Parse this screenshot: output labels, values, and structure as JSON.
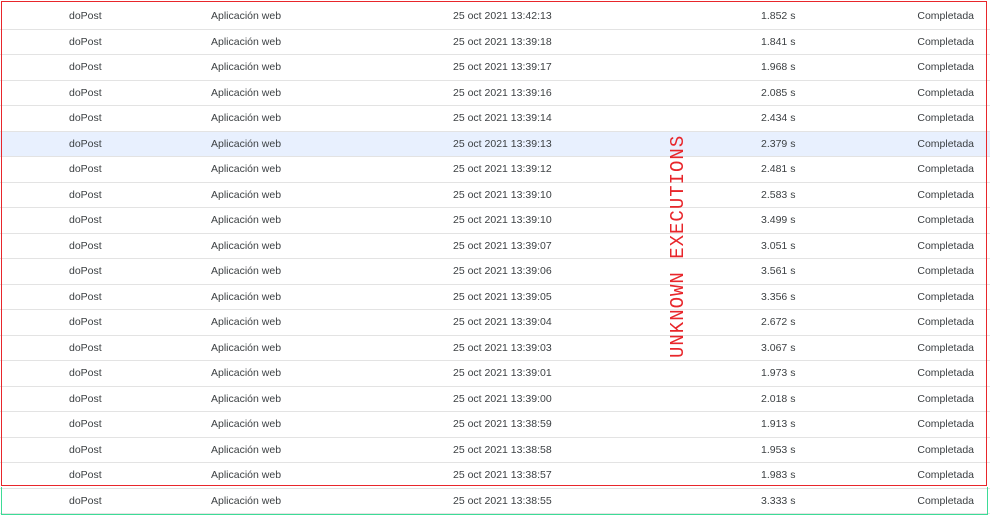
{
  "executions": {
    "rows": [
      {
        "function": "doPost",
        "type": "Aplicación web",
        "started": "25 oct 2021 13:42:13",
        "duration": "1.852 s",
        "status": "Completada"
      },
      {
        "function": "doPost",
        "type": "Aplicación web",
        "started": "25 oct 2021 13:39:18",
        "duration": "1.841 s",
        "status": "Completada"
      },
      {
        "function": "doPost",
        "type": "Aplicación web",
        "started": "25 oct 2021 13:39:17",
        "duration": "1.968 s",
        "status": "Completada"
      },
      {
        "function": "doPost",
        "type": "Aplicación web",
        "started": "25 oct 2021 13:39:16",
        "duration": "2.085 s",
        "status": "Completada"
      },
      {
        "function": "doPost",
        "type": "Aplicación web",
        "started": "25 oct 2021 13:39:14",
        "duration": "2.434 s",
        "status": "Completada"
      },
      {
        "function": "doPost",
        "type": "Aplicación web",
        "started": "25 oct 2021 13:39:13",
        "duration": "2.379 s",
        "status": "Completada"
      },
      {
        "function": "doPost",
        "type": "Aplicación web",
        "started": "25 oct 2021 13:39:12",
        "duration": "2.481 s",
        "status": "Completada"
      },
      {
        "function": "doPost",
        "type": "Aplicación web",
        "started": "25 oct 2021 13:39:10",
        "duration": "2.583 s",
        "status": "Completada"
      },
      {
        "function": "doPost",
        "type": "Aplicación web",
        "started": "25 oct 2021 13:39:10",
        "duration": "3.499 s",
        "status": "Completada"
      },
      {
        "function": "doPost",
        "type": "Aplicación web",
        "started": "25 oct 2021 13:39:07",
        "duration": "3.051 s",
        "status": "Completada"
      },
      {
        "function": "doPost",
        "type": "Aplicación web",
        "started": "25 oct 2021 13:39:06",
        "duration": "3.561 s",
        "status": "Completada"
      },
      {
        "function": "doPost",
        "type": "Aplicación web",
        "started": "25 oct 2021 13:39:05",
        "duration": "3.356 s",
        "status": "Completada"
      },
      {
        "function": "doPost",
        "type": "Aplicación web",
        "started": "25 oct 2021 13:39:04",
        "duration": "2.672 s",
        "status": "Completada"
      },
      {
        "function": "doPost",
        "type": "Aplicación web",
        "started": "25 oct 2021 13:39:03",
        "duration": "3.067 s",
        "status": "Completada"
      },
      {
        "function": "doPost",
        "type": "Aplicación web",
        "started": "25 oct 2021 13:39:01",
        "duration": "1.973 s",
        "status": "Completada"
      },
      {
        "function": "doPost",
        "type": "Aplicación web",
        "started": "25 oct 2021 13:39:00",
        "duration": "2.018 s",
        "status": "Completada"
      },
      {
        "function": "doPost",
        "type": "Aplicación web",
        "started": "25 oct 2021 13:38:59",
        "duration": "1.913 s",
        "status": "Completada"
      },
      {
        "function": "doPost",
        "type": "Aplicación web",
        "started": "25 oct 2021 13:38:58",
        "duration": "1.953 s",
        "status": "Completada"
      },
      {
        "function": "doPost",
        "type": "Aplicación web",
        "started": "25 oct 2021 13:38:57",
        "duration": "1.983 s",
        "status": "Completada"
      },
      {
        "function": "doPost",
        "type": "Aplicación web",
        "started": "25 oct 2021 13:38:55",
        "duration": "3.333 s",
        "status": "Completada"
      }
    ],
    "selected_row_index": 5
  },
  "annotation": {
    "text": "UNKNOWN EXECUTIONS",
    "color": "#e8262b",
    "unknown_box_color": "#e8262b",
    "known_box_color": "#3ddc97"
  },
  "colors": {
    "row_text": "#3c4043",
    "row_border": "#e3e3e3",
    "selected_row_bg": "#e8f0fe"
  }
}
